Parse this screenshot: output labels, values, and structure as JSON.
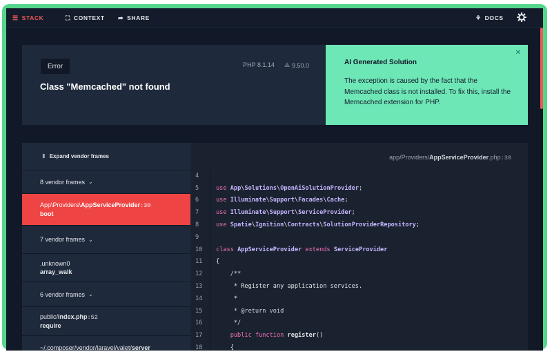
{
  "nav": {
    "tabs": [
      {
        "label": "STACK",
        "icon": "stack-icon"
      },
      {
        "label": "CONTEXT",
        "icon": "context-icon"
      },
      {
        "label": "SHARE",
        "icon": "share-icon"
      }
    ],
    "docs_label": "DOCS",
    "settings_icon": "gear-icon"
  },
  "error": {
    "badge": "Error",
    "php_version": "PHP 8.1.14",
    "laravel_version": "9.50.0",
    "message": "Class \"Memcached\" not found"
  },
  "ai_solution": {
    "title": "AI Generated Solution",
    "body": "The exception is caused by the fact that the Memcached class is not installed. To fix this, install the Memcached extension for PHP.",
    "close_icon": "close-icon"
  },
  "frames": {
    "expand_label": "Expand vendor frames",
    "items": [
      {
        "kind": "vendor",
        "label": "8 vendor frames"
      },
      {
        "kind": "app",
        "path_prefix": "App\\Providers\\",
        "path_name": "AppServiceProvider",
        "line": ":30",
        "function": "boot",
        "selected": true
      },
      {
        "kind": "vendor",
        "label": "7 vendor frames"
      },
      {
        "kind": "app",
        "path_prefix": "",
        "path_name": ".unknown0",
        "line": "",
        "function": "array_walk"
      },
      {
        "kind": "vendor",
        "label": "6 vendor frames"
      },
      {
        "kind": "app",
        "path_prefix": "public/",
        "path_name": "index.php",
        "line": ":52",
        "function": "require"
      },
      {
        "kind": "app",
        "path_prefix": "~/.composer/vendor/laravel/valet/",
        "path_name": "server",
        "line": "",
        "function": ""
      }
    ]
  },
  "code": {
    "file_prefix": "app/Providers/",
    "file_name": "AppServiceProvider",
    "file_ext": ".php",
    "file_line": ":30",
    "lines": [
      {
        "no": "4",
        "text": ""
      },
      {
        "no": "5",
        "text": "use App\\Solutions\\OpenAiSolutionProvider;"
      },
      {
        "no": "6",
        "text": "use Illuminate\\Support\\Facades\\Cache;"
      },
      {
        "no": "7",
        "text": "use Illuminate\\Support\\ServiceProvider;"
      },
      {
        "no": "8",
        "text": "use Spatie\\Ignition\\Contracts\\SolutionProviderRepository;"
      },
      {
        "no": "9",
        "text": ""
      },
      {
        "no": "10",
        "text": "class AppServiceProvider extends ServiceProvider"
      },
      {
        "no": "11",
        "text": "{"
      },
      {
        "no": "12",
        "text": "    /**"
      },
      {
        "no": "13",
        "text": "     * Register any application services."
      },
      {
        "no": "14",
        "text": "     *"
      },
      {
        "no": "15",
        "text": "     * @return void"
      },
      {
        "no": "16",
        "text": "     */"
      },
      {
        "no": "17",
        "text": "    public function register()"
      },
      {
        "no": "18",
        "text": "    {"
      }
    ]
  },
  "colors": {
    "accent_red": "#ef4444",
    "ai_green": "#6ee7b7",
    "frame_green": "#54d68c"
  }
}
